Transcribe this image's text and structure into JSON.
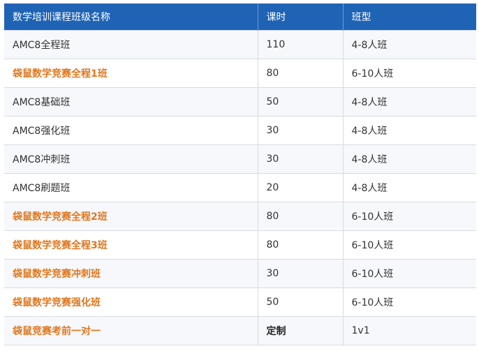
{
  "table": {
    "headers": [
      "数学培训课程班级名称",
      "课时",
      "班型"
    ],
    "rows": [
      {
        "name": "AMC8全程班",
        "hours": "110",
        "type": "4-8人班",
        "highlight": false,
        "hours_bold": false
      },
      {
        "name": "袋鼠数学竞赛全程1班",
        "hours": "80",
        "type": "6-10人班",
        "highlight": true,
        "hours_bold": false
      },
      {
        "name": "AMC8基础班",
        "hours": "50",
        "type": "4-8人班",
        "highlight": false,
        "hours_bold": false
      },
      {
        "name": "AMC8强化班",
        "hours": "30",
        "type": "4-8人班",
        "highlight": false,
        "hours_bold": false
      },
      {
        "name": "AMC8冲刺班",
        "hours": "30",
        "type": "4-8人班",
        "highlight": false,
        "hours_bold": false
      },
      {
        "name": "AMC8刷题班",
        "hours": "20",
        "type": "4-8人班",
        "highlight": false,
        "hours_bold": false
      },
      {
        "name": "袋鼠数学竞赛全程2班",
        "hours": "80",
        "type": "6-10人班",
        "highlight": true,
        "hours_bold": false
      },
      {
        "name": "袋鼠数学竞赛全程3班",
        "hours": "80",
        "type": "6-10人班",
        "highlight": true,
        "hours_bold": false
      },
      {
        "name": "袋鼠数学竞赛冲刺班",
        "hours": "30",
        "type": "6-10人班",
        "highlight": true,
        "hours_bold": false
      },
      {
        "name": "袋鼠数学竞赛强化班",
        "hours": "50",
        "type": "6-10人班",
        "highlight": true,
        "hours_bold": false
      },
      {
        "name": "袋鼠竞赛考前一对一",
        "hours": "定制",
        "type": "1v1",
        "highlight": true,
        "hours_bold": true
      }
    ]
  },
  "colors": {
    "header_bg": "#1f63b5",
    "highlight_text": "#e0771f"
  }
}
